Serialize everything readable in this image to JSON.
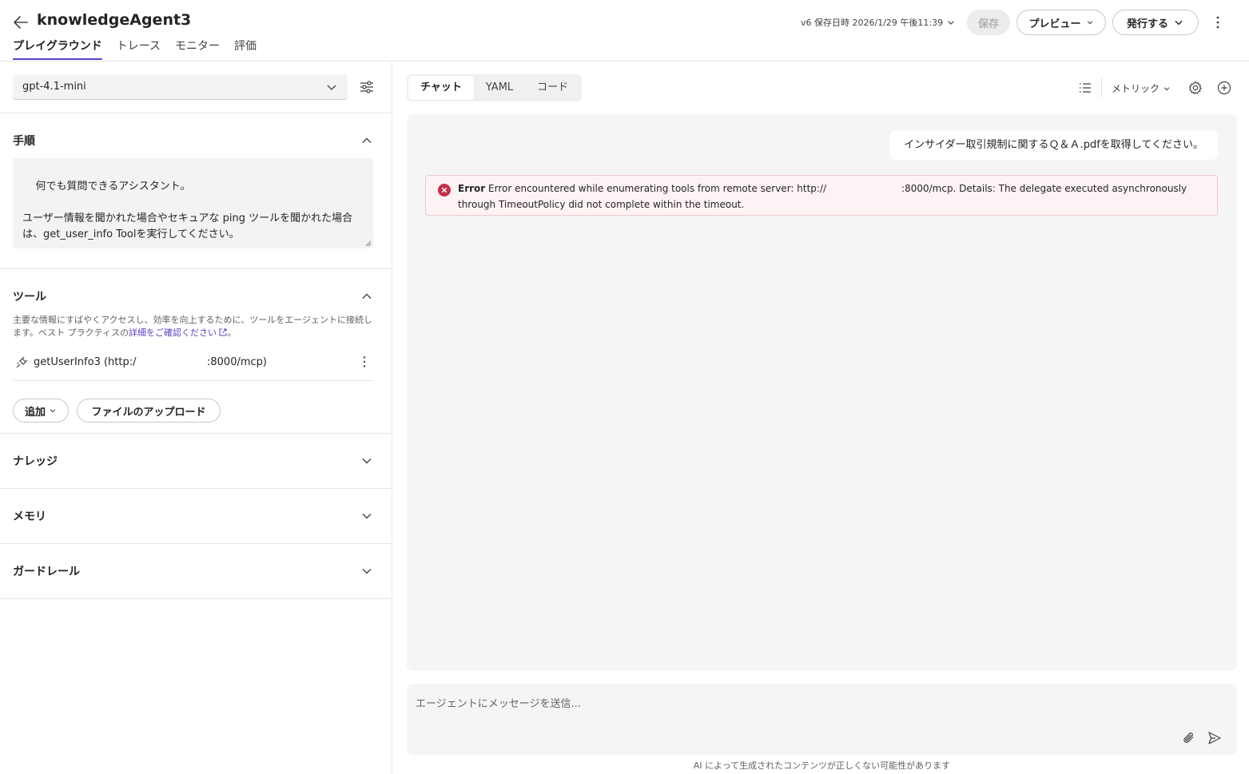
{
  "header": {
    "title": "knowledgeAgent3",
    "tabs": [
      {
        "label": "プレイグラウンド",
        "active": true
      },
      {
        "label": "トレース"
      },
      {
        "label": "モニター"
      },
      {
        "label": "評価"
      }
    ],
    "version_label": "v6 保存日時 2026/1/29 午後11:39",
    "save_label": "保存",
    "preview_label": "プレビュー",
    "publish_label": "発行する"
  },
  "left": {
    "model": "gpt-4.1-mini",
    "instructions": {
      "title": "手順",
      "text": "何でも質問できるアシスタント。\n\nユーザー情報を聞かれた場合やセキュアな ping ツールを聞かれた場合は、get_user_info Toolを実行してください。"
    },
    "tools": {
      "title": "ツール",
      "desc_prefix": "主要な情報にすばやくアクセスし、効率を向上するために、ツールをエージェントに接続します。ベスト プラクティスの",
      "desc_link": "詳細をご確認ください",
      "desc_suffix": "。",
      "item_name": "getUserInfo3 (http:/",
      "item_url_suffix": ":8000/mcp)",
      "add_label": "追加",
      "upload_label": "ファイルのアップロード"
    },
    "knowledge_title": "ナレッジ",
    "memory_title": "メモリ",
    "guardrail_title": "ガードレール"
  },
  "right": {
    "tabs": [
      {
        "label": "チャット",
        "active": true
      },
      {
        "label": "YAML"
      },
      {
        "label": "コード"
      }
    ],
    "metric_label": "メトリック",
    "user_message": "インサイダー取引規制に関するＱ＆Ａ.pdfを取得してください。",
    "error": {
      "label": "Error",
      "line1_a": "Error encountered while enumerating tools from remote server: http://",
      "line1_b": ":8000/mcp. Details: The delegate executed asynchronously",
      "line2": "through TimeoutPolicy did not complete within the timeout."
    },
    "composer_placeholder": "エージェントにメッセージを送信...",
    "disclaimer": "AI によって生成されたコンテンツが正しくない可能性があります"
  },
  "colors": {
    "accent": "#5b3fc4",
    "error_bg": "#fdf3f4",
    "error_icon": "#c4314b"
  }
}
